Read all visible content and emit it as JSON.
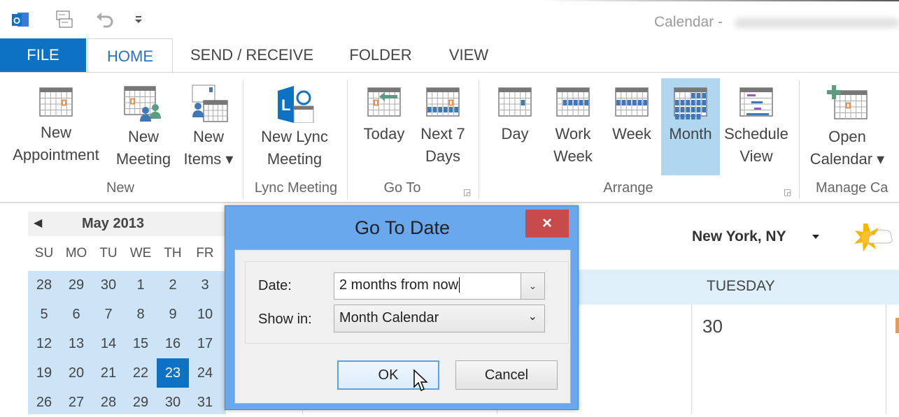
{
  "window": {
    "title": "Calendar - "
  },
  "quick_access": [
    {
      "icon": "outlook-logo-icon"
    },
    {
      "icon": "send-receive-all-icon"
    },
    {
      "icon": "undo-icon"
    },
    {
      "icon": "customize-qat-icon"
    }
  ],
  "tabs": [
    {
      "label": "FILE"
    },
    {
      "label": "HOME",
      "active": true
    },
    {
      "label": "SEND / RECEIVE"
    },
    {
      "label": "FOLDER"
    },
    {
      "label": "VIEW"
    }
  ],
  "ribbon": {
    "groups": [
      {
        "label": "New"
      },
      {
        "label": "Lync Meeting"
      },
      {
        "label": "Go To"
      },
      {
        "label": "Arrange"
      },
      {
        "label": "Manage Ca"
      }
    ],
    "buttons": [
      {
        "line1": "New",
        "line2": "Appointment"
      },
      {
        "line1": "New",
        "line2": "Meeting"
      },
      {
        "line1": "New",
        "line2": "Items ▾"
      },
      {
        "line1": "New Lync",
        "line2": "Meeting"
      },
      {
        "line1": "Today",
        "line2": ""
      },
      {
        "line1": "Next 7",
        "line2": "Days"
      },
      {
        "line1": "Day",
        "line2": ""
      },
      {
        "line1": "Work",
        "line2": "Week"
      },
      {
        "line1": "Week",
        "line2": ""
      },
      {
        "line1": "Month",
        "line2": "",
        "selected": true
      },
      {
        "line1": "Schedule",
        "line2": "View"
      },
      {
        "line1": "Open",
        "line2": "Calendar ▾"
      }
    ]
  },
  "mini_calendar": {
    "title": "May 2013",
    "day_names": [
      "SU",
      "MO",
      "TU",
      "WE",
      "TH",
      "FR"
    ],
    "weeks": [
      [
        "28",
        "29",
        "30",
        "1",
        "2",
        "3"
      ],
      [
        "5",
        "6",
        "7",
        "8",
        "9",
        "10"
      ],
      [
        "12",
        "13",
        "14",
        "15",
        "16",
        "17"
      ],
      [
        "19",
        "20",
        "21",
        "22",
        "23",
        "24"
      ],
      [
        "26",
        "27",
        "28",
        "29",
        "30",
        "31"
      ]
    ],
    "today": "23"
  },
  "calendar_view": {
    "location": "New York, NY",
    "weather_icon": "sun-cloud-icon",
    "day_header": "TUESDAY",
    "day_number": "30"
  },
  "dialog": {
    "title": "Go To Date",
    "close": "×",
    "date_label": "Date:",
    "date_value": "2 months from now",
    "show_in_label": "Show in:",
    "show_in_value": "Month Calendar",
    "ok": "OK",
    "cancel": "Cancel"
  },
  "colors": {
    "accent": "#0e72c4",
    "dialog_frame": "#6aa8ee",
    "close": "#c84b4b",
    "selection": "#b1d6f0"
  }
}
